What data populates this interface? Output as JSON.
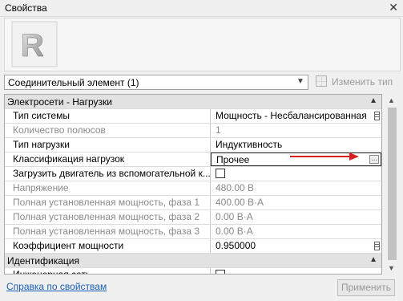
{
  "window": {
    "title": "Свойства",
    "close_glyph": "✕"
  },
  "preview": {
    "logo_letter": "R"
  },
  "type_selector": {
    "value": "Соединительный элемент (1)",
    "chevron": "⌄"
  },
  "edit_type": {
    "label": "Изменить тип"
  },
  "groups": [
    {
      "label": "Электросети - Нагрузки",
      "collapse": "⌃"
    },
    {
      "label": "Идентификация",
      "collapse": "⌃"
    }
  ],
  "properties": [
    {
      "name": "Тип системы",
      "value": "Мощность - Несбалансированная",
      "disabled": false
    },
    {
      "name": "Количество полюсов",
      "value": "1",
      "disabled": true
    },
    {
      "name": "Тип нагрузки",
      "value": "Индуктивность",
      "disabled": false
    },
    {
      "name": "Классификация нагрузок",
      "value": "Прочее",
      "disabled": false
    },
    {
      "name": "Загрузить двигатель из вспомогательной к...",
      "value": "",
      "disabled": false
    },
    {
      "name": "Напряжение",
      "value": "480.00 В",
      "disabled": true
    },
    {
      "name": "Полная установленная мощность, фаза 1",
      "value": "400.00 В·А",
      "disabled": true
    },
    {
      "name": "Полная установленная мощность, фаза 2",
      "value": "0.00 В·А",
      "disabled": true
    },
    {
      "name": "Полная установленная мощность, фаза 3",
      "value": "0.00 В·А",
      "disabled": true
    },
    {
      "name": "Коэффициент мощности",
      "value": "0.950000",
      "disabled": false
    },
    {
      "name": "Инженерная сеть",
      "value": "",
      "disabled": false
    }
  ],
  "footer": {
    "help_link": "Справка по свойствам",
    "apply_label": "Применить"
  },
  "colors": {
    "link": "#1a5fb4",
    "arrow": "#d32020",
    "group_bg": "#e2e2e2"
  }
}
